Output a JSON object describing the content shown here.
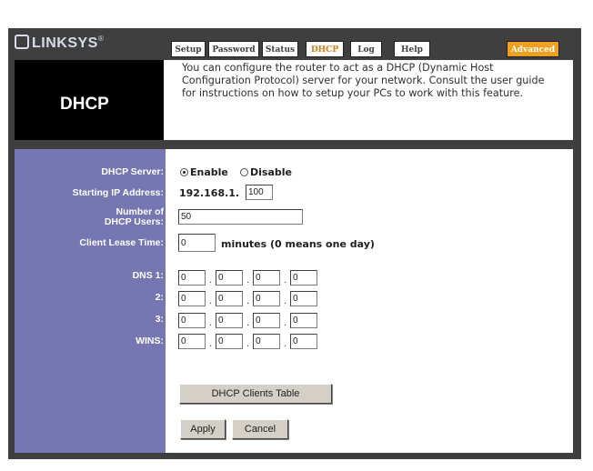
{
  "brand": {
    "name": "LINKSYS",
    "reg": "®"
  },
  "page": {
    "title": "DHCP"
  },
  "tabs": [
    {
      "label": "Setup"
    },
    {
      "label": "Password"
    },
    {
      "label": "Status"
    },
    {
      "label": "DHCP"
    },
    {
      "label": "Log"
    },
    {
      "label": "Help"
    },
    {
      "label": "Advanced"
    }
  ],
  "description": "You can configure the router to act as a DHCP (Dynamic Host Configuration Protocol) server for your network. Consult the user guide for instructions on how to setup your PCs to work with this feature.",
  "form": {
    "dhcp_server": {
      "label": "DHCP Server:",
      "enable": "Enable",
      "disable": "Disable",
      "selected": "Enable"
    },
    "start_ip": {
      "label": "Starting IP Address:",
      "prefix": "192.168.1.",
      "value": "100"
    },
    "num_users": {
      "label_line1": "Number of",
      "label_line2": "DHCP Users:",
      "value": "50"
    },
    "lease": {
      "label": "Client Lease Time:",
      "value": "0",
      "suffix": "minutes (0 means one day)"
    },
    "dns1": {
      "label": "DNS 1:",
      "octets": [
        "0",
        "0",
        "0",
        "0"
      ]
    },
    "dns2": {
      "label": "2:",
      "octets": [
        "0",
        "0",
        "0",
        "0"
      ]
    },
    "dns3": {
      "label": "3:",
      "octets": [
        "0",
        "0",
        "0",
        "0"
      ]
    },
    "wins": {
      "label": "WINS:",
      "octets": [
        "0",
        "0",
        "0",
        "0"
      ]
    }
  },
  "buttons": {
    "clients_table": "DHCP Clients Table",
    "apply": "Apply",
    "cancel": "Cancel"
  },
  "colors": {
    "frame": "#3f3f3f",
    "label_panel": "#7676b2",
    "active_tab": "#e07a1a",
    "advanced_tab": "#f0a020"
  }
}
